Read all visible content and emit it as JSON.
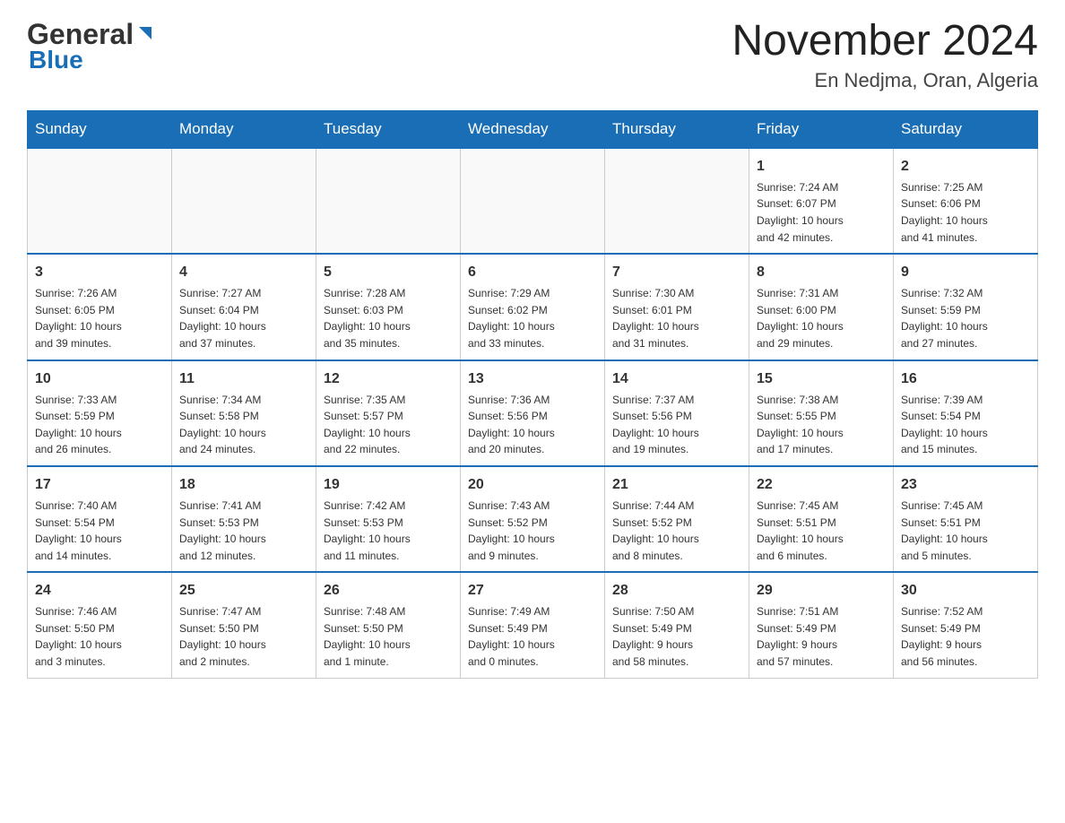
{
  "header": {
    "logo": {
      "line1": "General",
      "line2": "Blue"
    },
    "title": "November 2024",
    "location": "En Nedjma, Oran, Algeria"
  },
  "weekdays": [
    "Sunday",
    "Monday",
    "Tuesday",
    "Wednesday",
    "Thursday",
    "Friday",
    "Saturday"
  ],
  "weeks": [
    [
      {
        "day": "",
        "info": ""
      },
      {
        "day": "",
        "info": ""
      },
      {
        "day": "",
        "info": ""
      },
      {
        "day": "",
        "info": ""
      },
      {
        "day": "",
        "info": ""
      },
      {
        "day": "1",
        "info": "Sunrise: 7:24 AM\nSunset: 6:07 PM\nDaylight: 10 hours\nand 42 minutes."
      },
      {
        "day": "2",
        "info": "Sunrise: 7:25 AM\nSunset: 6:06 PM\nDaylight: 10 hours\nand 41 minutes."
      }
    ],
    [
      {
        "day": "3",
        "info": "Sunrise: 7:26 AM\nSunset: 6:05 PM\nDaylight: 10 hours\nand 39 minutes."
      },
      {
        "day": "4",
        "info": "Sunrise: 7:27 AM\nSunset: 6:04 PM\nDaylight: 10 hours\nand 37 minutes."
      },
      {
        "day": "5",
        "info": "Sunrise: 7:28 AM\nSunset: 6:03 PM\nDaylight: 10 hours\nand 35 minutes."
      },
      {
        "day": "6",
        "info": "Sunrise: 7:29 AM\nSunset: 6:02 PM\nDaylight: 10 hours\nand 33 minutes."
      },
      {
        "day": "7",
        "info": "Sunrise: 7:30 AM\nSunset: 6:01 PM\nDaylight: 10 hours\nand 31 minutes."
      },
      {
        "day": "8",
        "info": "Sunrise: 7:31 AM\nSunset: 6:00 PM\nDaylight: 10 hours\nand 29 minutes."
      },
      {
        "day": "9",
        "info": "Sunrise: 7:32 AM\nSunset: 5:59 PM\nDaylight: 10 hours\nand 27 minutes."
      }
    ],
    [
      {
        "day": "10",
        "info": "Sunrise: 7:33 AM\nSunset: 5:59 PM\nDaylight: 10 hours\nand 26 minutes."
      },
      {
        "day": "11",
        "info": "Sunrise: 7:34 AM\nSunset: 5:58 PM\nDaylight: 10 hours\nand 24 minutes."
      },
      {
        "day": "12",
        "info": "Sunrise: 7:35 AM\nSunset: 5:57 PM\nDaylight: 10 hours\nand 22 minutes."
      },
      {
        "day": "13",
        "info": "Sunrise: 7:36 AM\nSunset: 5:56 PM\nDaylight: 10 hours\nand 20 minutes."
      },
      {
        "day": "14",
        "info": "Sunrise: 7:37 AM\nSunset: 5:56 PM\nDaylight: 10 hours\nand 19 minutes."
      },
      {
        "day": "15",
        "info": "Sunrise: 7:38 AM\nSunset: 5:55 PM\nDaylight: 10 hours\nand 17 minutes."
      },
      {
        "day": "16",
        "info": "Sunrise: 7:39 AM\nSunset: 5:54 PM\nDaylight: 10 hours\nand 15 minutes."
      }
    ],
    [
      {
        "day": "17",
        "info": "Sunrise: 7:40 AM\nSunset: 5:54 PM\nDaylight: 10 hours\nand 14 minutes."
      },
      {
        "day": "18",
        "info": "Sunrise: 7:41 AM\nSunset: 5:53 PM\nDaylight: 10 hours\nand 12 minutes."
      },
      {
        "day": "19",
        "info": "Sunrise: 7:42 AM\nSunset: 5:53 PM\nDaylight: 10 hours\nand 11 minutes."
      },
      {
        "day": "20",
        "info": "Sunrise: 7:43 AM\nSunset: 5:52 PM\nDaylight: 10 hours\nand 9 minutes."
      },
      {
        "day": "21",
        "info": "Sunrise: 7:44 AM\nSunset: 5:52 PM\nDaylight: 10 hours\nand 8 minutes."
      },
      {
        "day": "22",
        "info": "Sunrise: 7:45 AM\nSunset: 5:51 PM\nDaylight: 10 hours\nand 6 minutes."
      },
      {
        "day": "23",
        "info": "Sunrise: 7:45 AM\nSunset: 5:51 PM\nDaylight: 10 hours\nand 5 minutes."
      }
    ],
    [
      {
        "day": "24",
        "info": "Sunrise: 7:46 AM\nSunset: 5:50 PM\nDaylight: 10 hours\nand 3 minutes."
      },
      {
        "day": "25",
        "info": "Sunrise: 7:47 AM\nSunset: 5:50 PM\nDaylight: 10 hours\nand 2 minutes."
      },
      {
        "day": "26",
        "info": "Sunrise: 7:48 AM\nSunset: 5:50 PM\nDaylight: 10 hours\nand 1 minute."
      },
      {
        "day": "27",
        "info": "Sunrise: 7:49 AM\nSunset: 5:49 PM\nDaylight: 10 hours\nand 0 minutes."
      },
      {
        "day": "28",
        "info": "Sunrise: 7:50 AM\nSunset: 5:49 PM\nDaylight: 9 hours\nand 58 minutes."
      },
      {
        "day": "29",
        "info": "Sunrise: 7:51 AM\nSunset: 5:49 PM\nDaylight: 9 hours\nand 57 minutes."
      },
      {
        "day": "30",
        "info": "Sunrise: 7:52 AM\nSunset: 5:49 PM\nDaylight: 9 hours\nand 56 minutes."
      }
    ]
  ]
}
